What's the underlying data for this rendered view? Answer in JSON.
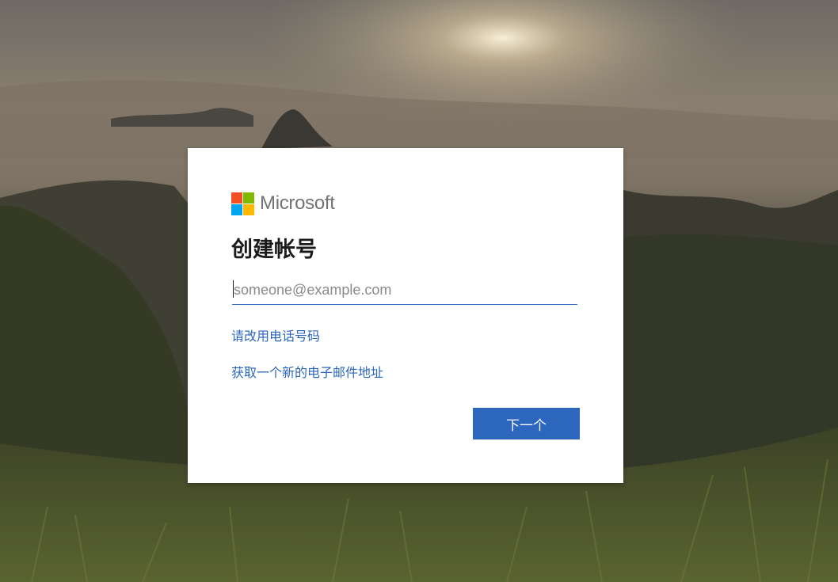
{
  "brand": {
    "name": "Microsoft",
    "logo_colors": [
      "#f25022",
      "#7fba00",
      "#00a4ef",
      "#ffb900"
    ]
  },
  "form": {
    "title": "创建帐号",
    "email_placeholder": "someone@example.com",
    "email_value": "",
    "use_phone_link": "请改用电话号码",
    "new_email_link": "获取一个新的电子邮件地址",
    "next_button": "下一个"
  },
  "colors": {
    "accent": "#2c67bd",
    "link": "#2b66bb",
    "card_background": "#ffffff"
  }
}
